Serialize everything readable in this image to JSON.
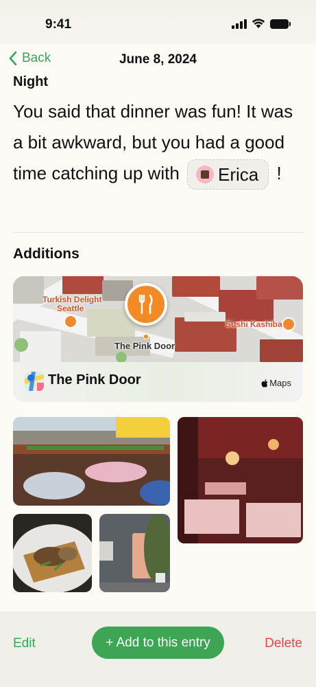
{
  "status_bar": {
    "time": "9:41"
  },
  "nav": {
    "back_label": "Back",
    "title": "June 8, 2024"
  },
  "entry": {
    "section_label": "Night",
    "text_before_mention": "You said that dinner was fun! It was a bit awkward, but you had a good time catching up with",
    "mention_name": "Erica",
    "text_after_mention": "!"
  },
  "additions": {
    "section_label": "Additions",
    "map_card": {
      "place_name": "The Pink Door",
      "brand": "Maps",
      "map_labels": {
        "turkish_delight": "Turkish Delight",
        "seattle": "Seattle",
        "sushi_kashiba": "Sushi Kashiba",
        "pin_label": "The Pink Door"
      }
    },
    "photos": [
      "restaurant patio",
      "restaurant interior",
      "mushroom toast dish",
      "pink door entrance"
    ]
  },
  "toolbar": {
    "edit_label": "Edit",
    "add_label": "+ Add to this entry",
    "delete_label": "Delete"
  },
  "colors": {
    "accent_green": "#3aa655",
    "button_green": "#3ea554",
    "delete_red": "#e04848",
    "pin_orange": "#f28a25",
    "background": "#fcfbf5"
  }
}
